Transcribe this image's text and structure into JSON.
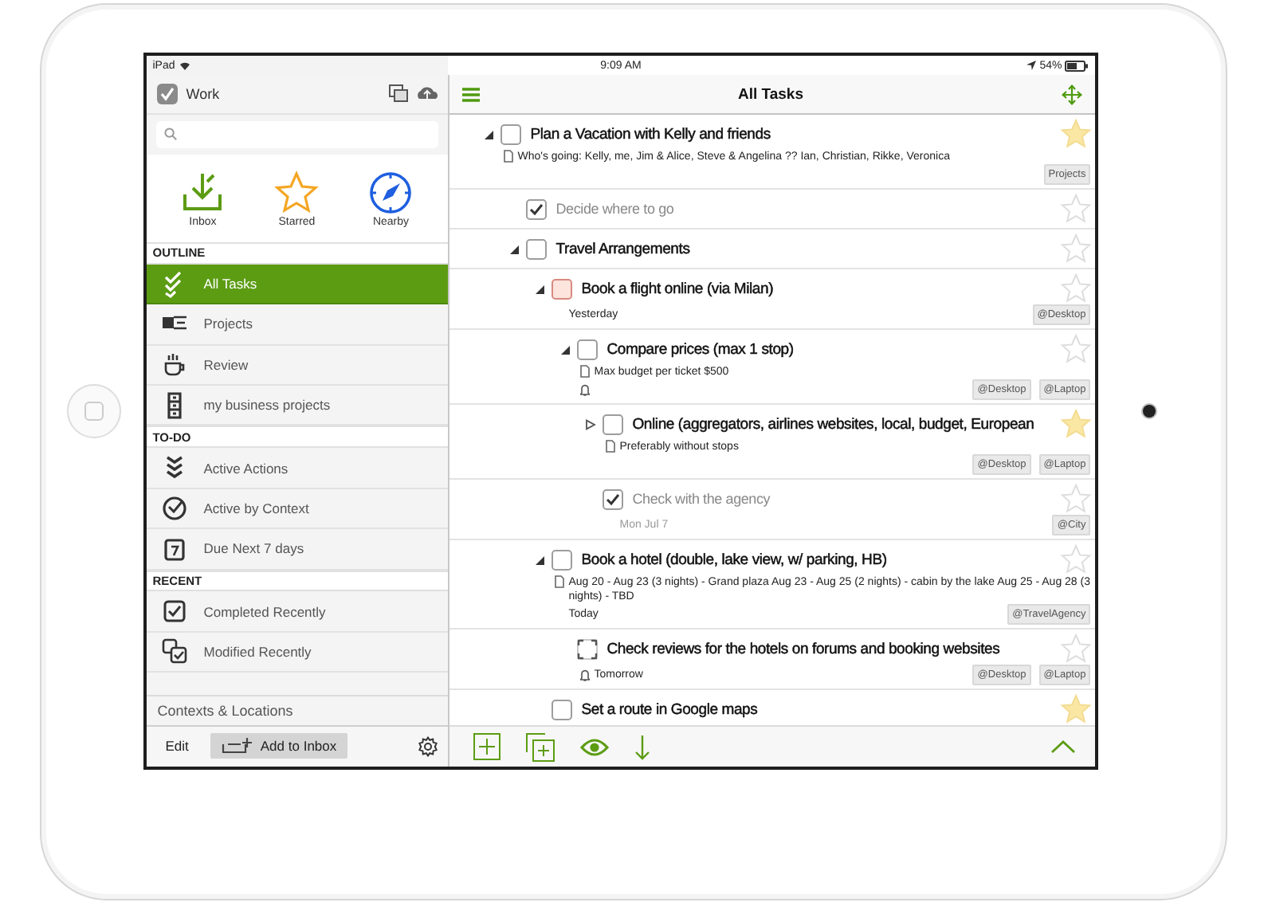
{
  "status_bar": {
    "device": "iPad",
    "time": "9:09 AM",
    "battery": "54%"
  },
  "sidebar": {
    "title": "Work",
    "shortcuts": [
      {
        "label": "Inbox"
      },
      {
        "label": "Starred"
      },
      {
        "label": "Nearby"
      }
    ],
    "sections": [
      {
        "title": "OUTLINE",
        "items": [
          {
            "label": "All Tasks",
            "selected": true
          },
          {
            "label": "Projects",
            "selected": false
          },
          {
            "label": "Review",
            "selected": false
          },
          {
            "label": "my business projects",
            "selected": false
          }
        ]
      },
      {
        "title": "TO-DO",
        "items": [
          {
            "label": "Active Actions",
            "selected": false
          },
          {
            "label": "Active by Context",
            "selected": false
          },
          {
            "label": "Due Next 7 days",
            "selected": false
          }
        ]
      },
      {
        "title": "RECENT",
        "items": [
          {
            "label": "Completed Recently",
            "selected": false
          },
          {
            "label": "Modified Recently",
            "selected": false
          }
        ]
      }
    ],
    "footer_link": "Contexts & Locations",
    "bottom_bar": {
      "edit": "Edit",
      "add": "Add to Inbox"
    }
  },
  "main": {
    "title": "All Tasks",
    "tasks": [
      {
        "title": "Plan a Vacation with Kelly and friends",
        "kind": "plain",
        "checked": false,
        "expanded": true,
        "starred": true,
        "note": "Who's going: Kelly, me, Jim & Alice, Steve & Angelina ?? Ian, Christian, Rikke, Veronica",
        "tags": [
          "Projects"
        ],
        "children": [
          {
            "title": "Decide where to go",
            "kind": "plain",
            "checked": true,
            "starred": false
          },
          {
            "title": "Travel Arrangements",
            "kind": "plain",
            "checked": false,
            "expanded": true,
            "starred": false,
            "children": [
              {
                "title": "Book a flight online (via Milan)",
                "kind": "overdue",
                "checked": false,
                "expanded": true,
                "starred": false,
                "date": "Yesterday",
                "tags": [
                  "@Desktop"
                ],
                "children": [
                  {
                    "title": "Compare prices (max 1 stop)",
                    "kind": "plain",
                    "checked": false,
                    "expanded": true,
                    "starred": false,
                    "note": "Max budget per ticket $500",
                    "reminder": true,
                    "tags": [
                      "@Desktop",
                      "@Laptop"
                    ],
                    "children": [
                      {
                        "title": "Online (aggregators, airlines websites, local, budget, European",
                        "kind": "plain",
                        "checked": false,
                        "expanded": false,
                        "starred": true,
                        "note": "Preferably without stops",
                        "tags": [
                          "@Desktop",
                          "@Laptop"
                        ]
                      },
                      {
                        "title": "Check with the agency",
                        "kind": "plain",
                        "checked": true,
                        "starred": false,
                        "date": "Mon Jul 7",
                        "tags": [
                          "@City"
                        ]
                      }
                    ]
                  }
                ]
              },
              {
                "title": "Book a hotel (double, lake view, w/ parking, HB)",
                "kind": "plain",
                "checked": false,
                "expanded": true,
                "starred": false,
                "note": "Aug 20 - Aug 23 (3 nights) - Grand plaza Aug 23 - Aug 25 (2 nights) - cabin by the lake Aug 25 - Aug 28 (3 nights) - TBD",
                "date": "Today",
                "tags": [
                  "@TravelAgency"
                ],
                "children": [
                  {
                    "title": "Check reviews for the hotels on forums and booking websites",
                    "kind": "dashed",
                    "checked": false,
                    "starred": false,
                    "reminder": true,
                    "date": "Tomorrow",
                    "tags": [
                      "@Desktop",
                      "@Laptop"
                    ]
                  }
                ]
              },
              {
                "title": "Set a route in Google maps",
                "kind": "plain",
                "checked": false,
                "starred": true
              }
            ]
          }
        ]
      }
    ]
  }
}
